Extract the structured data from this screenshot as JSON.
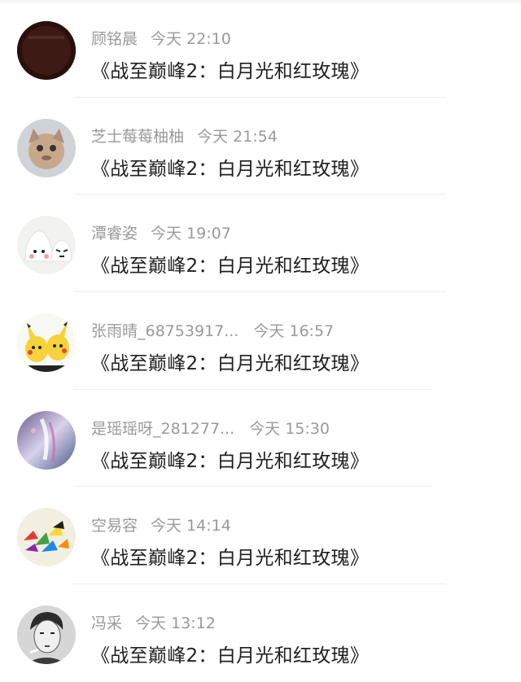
{
  "comments": [
    {
      "name": "顾铭晨",
      "time": "今天 22:10",
      "content": "《战至巅峰2：白月光和红玫瑰》",
      "avatar": "dark-avatar-icon"
    },
    {
      "name": "芝士莓莓柚柚",
      "time": "今天 21:54",
      "content": "《战至巅峰2：白月光和红玫瑰》",
      "avatar": "cat-avatar-icon"
    },
    {
      "name": "潭睿姿",
      "time": "今天 19:07",
      "content": "《战至巅峰2：白月光和红玫瑰》",
      "avatar": "rice-ball-avatar-icon"
    },
    {
      "name": "张雨晴_68753917...",
      "time": "今天 16:57",
      "content": "《战至巅峰2：白月光和红玫瑰》",
      "avatar": "pikachu-avatar-icon"
    },
    {
      "name": "是瑶瑶呀_281277...",
      "time": "今天 15:30",
      "content": "《战至巅峰2：白月光和红玫瑰》",
      "avatar": "anime-avatar-icon"
    },
    {
      "name": "空易容",
      "time": "今天 14:14",
      "content": "《战至巅峰2：白月光和红玫瑰》",
      "avatar": "paper-cranes-avatar-icon"
    },
    {
      "name": "冯采",
      "time": "今天 13:12",
      "content": "《战至巅峰2：白月光和红玫瑰》",
      "avatar": "sketch-portrait-avatar-icon"
    }
  ]
}
